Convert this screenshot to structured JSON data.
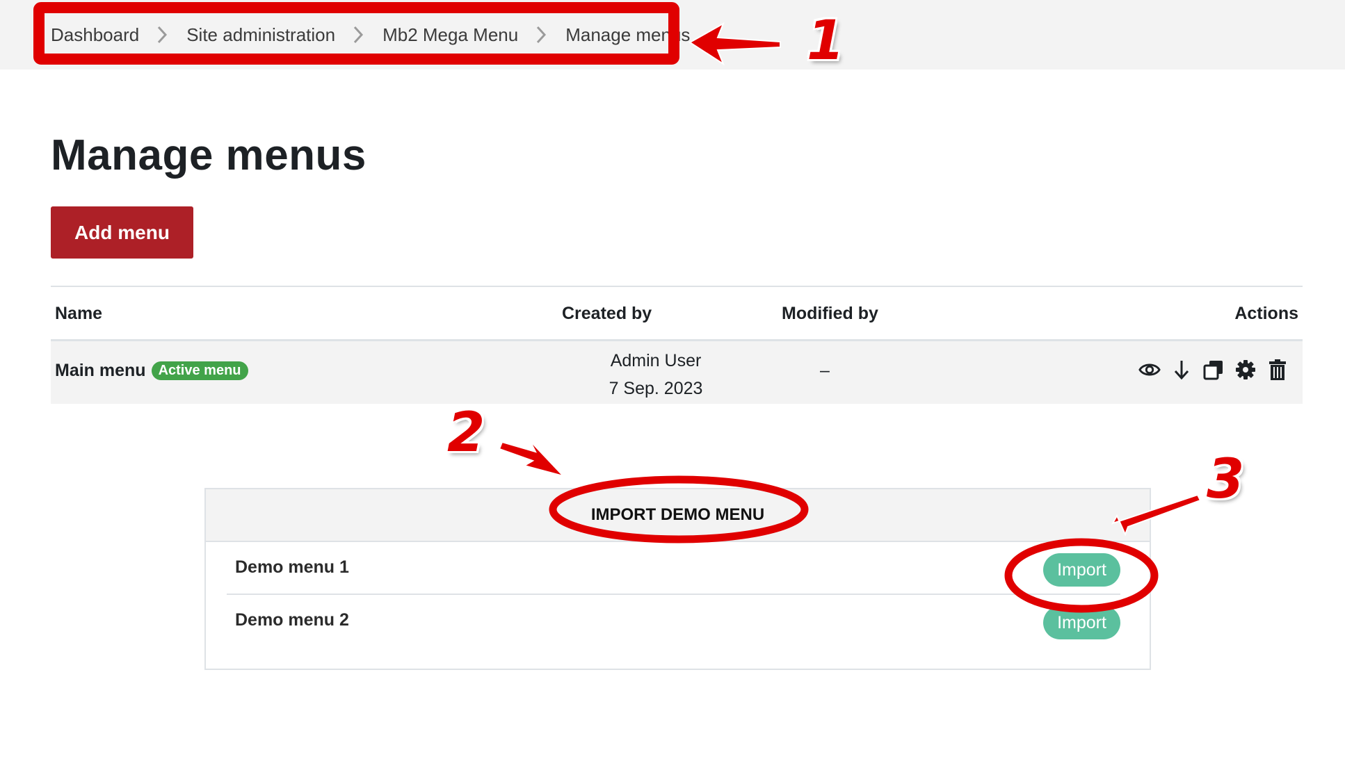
{
  "breadcrumb": {
    "items": [
      {
        "label": "Dashboard"
      },
      {
        "label": "Site administration"
      },
      {
        "label": "Mb2 Mega Menu"
      },
      {
        "label": "Manage menus"
      }
    ]
  },
  "page": {
    "title": "Manage menus",
    "add_button": "Add menu"
  },
  "table": {
    "headers": {
      "name": "Name",
      "created_by": "Created by",
      "modified_by": "Modified by",
      "actions": "Actions"
    },
    "rows": [
      {
        "name": "Main menu",
        "badge": "Active menu",
        "created_user": "Admin User",
        "created_date": "7 Sep. 2023",
        "modified": "–",
        "action_icons": [
          "eye-icon",
          "download-icon",
          "duplicate-icon",
          "gear-icon",
          "trash-icon"
        ]
      }
    ]
  },
  "import_panel": {
    "title": "IMPORT DEMO MENU",
    "items": [
      {
        "label": "Demo menu 1",
        "button": "Import"
      },
      {
        "label": "Demo menu 2",
        "button": "Import"
      }
    ]
  },
  "annotations": {
    "step_numbers": [
      "1",
      "2",
      "3"
    ],
    "color": "#e00000"
  },
  "colors": {
    "primary_button": "#ad2027",
    "badge_success": "#42a349",
    "import_button": "#5bc09e",
    "annotation_red": "#e00000"
  }
}
